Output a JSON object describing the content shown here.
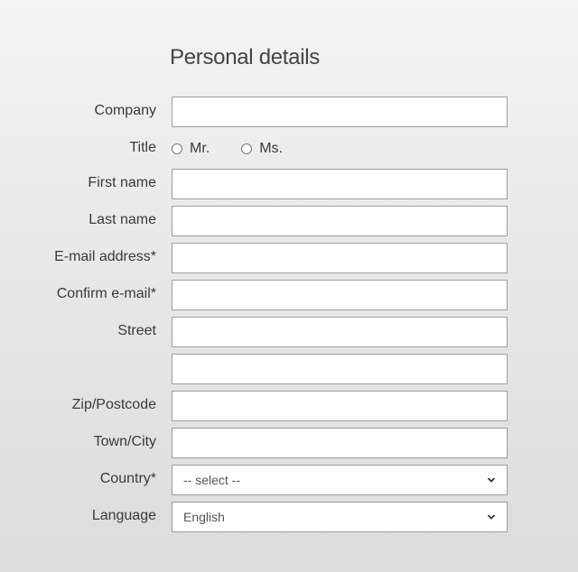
{
  "section_title": "Personal details",
  "fields": {
    "company": {
      "label": "Company",
      "value": ""
    },
    "title": {
      "label": "Title",
      "options": [
        {
          "label": "Mr.",
          "selected": false
        },
        {
          "label": "Ms.",
          "selected": false
        }
      ]
    },
    "first_name": {
      "label": "First name",
      "value": ""
    },
    "last_name": {
      "label": "Last name",
      "value": ""
    },
    "email": {
      "label": "E-mail address*",
      "value": ""
    },
    "confirm_email": {
      "label": "Confirm e-mail*",
      "value": ""
    },
    "street": {
      "label": "Street",
      "value": ""
    },
    "street2": {
      "label": "",
      "value": ""
    },
    "zip": {
      "label": "Zip/Postcode",
      "value": ""
    },
    "town": {
      "label": "Town/City",
      "value": ""
    },
    "country": {
      "label": "Country*",
      "selected": "-- select --"
    },
    "language": {
      "label": "Language",
      "selected": "English"
    }
  }
}
